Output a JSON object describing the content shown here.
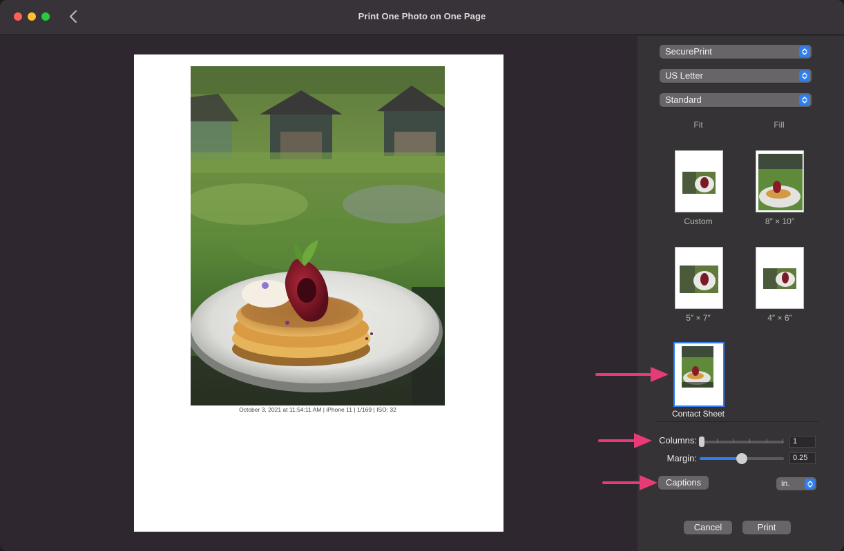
{
  "window": {
    "title": "Print One Photo on One Page"
  },
  "preview": {
    "caption": "October 3, 2021 at 11:54:11 AM | iPhone 11 | 1/169 | ISO: 32"
  },
  "sidebar": {
    "printer": "SecurePrint",
    "paper_size": "US Letter",
    "quality": "Standard",
    "layout_headers": [
      "Fit",
      "Fill"
    ],
    "layouts": [
      {
        "label": "Custom",
        "selected": false
      },
      {
        "label": "8″ × 10″",
        "selected": false
      },
      {
        "label": "5″ × 7″",
        "selected": false
      },
      {
        "label": "4″ × 6″",
        "selected": false
      },
      {
        "label": "Contact Sheet",
        "selected": true
      }
    ],
    "columns_label": "Columns:",
    "columns_value": "1",
    "margin_label": "Margin:",
    "margin_value": "0.25",
    "captions_button": "Captions",
    "units": "in.",
    "cancel_button": "Cancel",
    "print_button": "Print"
  },
  "colors": {
    "accent": "#2f7ff0",
    "arrow": "#e83a74"
  }
}
